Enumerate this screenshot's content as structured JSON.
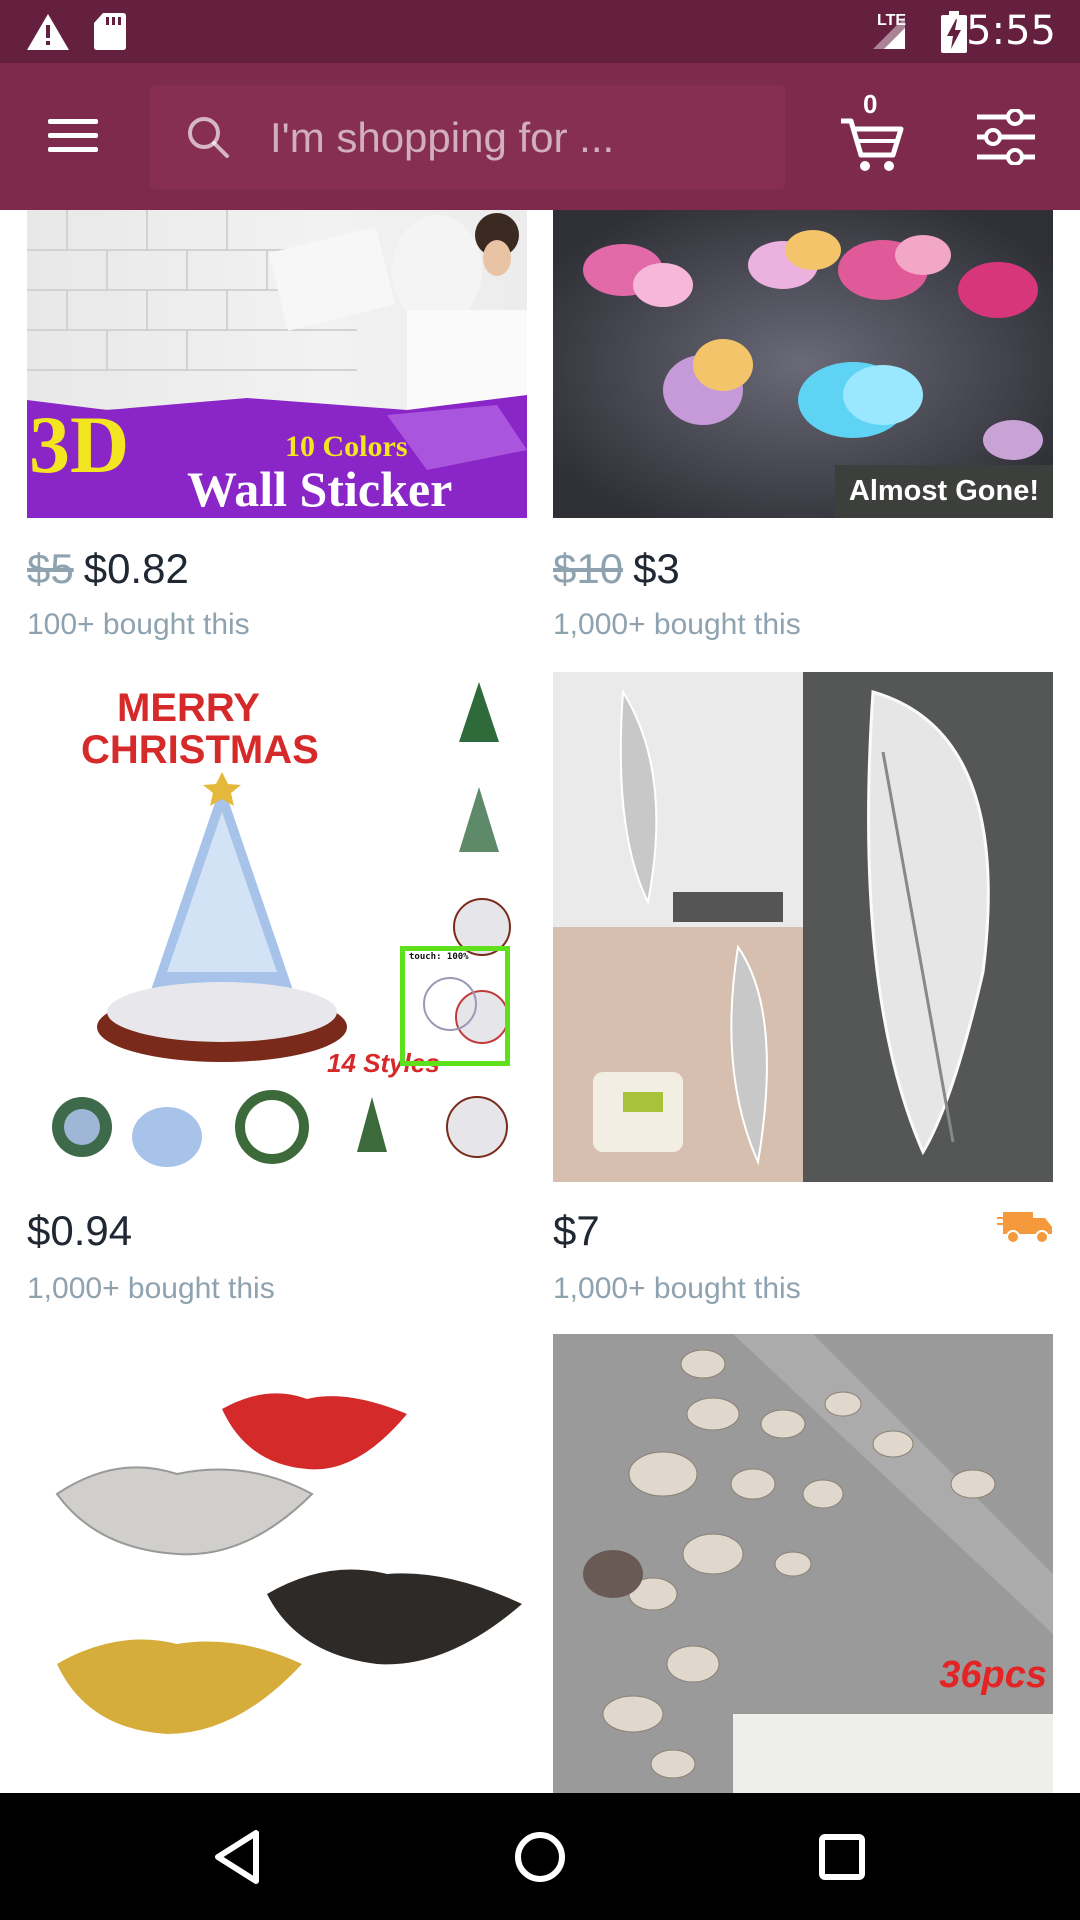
{
  "status_bar": {
    "time": "5:55",
    "network": "LTE"
  },
  "app_bar": {
    "search_placeholder": "I'm shopping for ...",
    "cart_count": "0"
  },
  "colors": {
    "status_bar": "#651f3f",
    "app_bar": "#7e2a4c",
    "search_box": "#862f52",
    "truck": "#f59a3c"
  },
  "products": [
    {
      "image": {
        "line1": "3D",
        "line2": "10 Colors",
        "line3": "Wall Sticker"
      },
      "old_price": "$5",
      "price": "$0.82",
      "bought": "100+ bought this"
    },
    {
      "image": {},
      "badge": "Almost Gone!",
      "old_price": "$10",
      "price": "$3",
      "bought": "1,000+ bought this"
    },
    {
      "image": {
        "line1": "MERRY",
        "line2": "CHRISTMAS",
        "line3": "14 Styles"
      },
      "price": "$0.94",
      "bought": "1,000+ bought this"
    },
    {
      "image": {},
      "price": "$7",
      "bought": "1,000+ bought this",
      "shipping_icon": "truck-icon"
    },
    {
      "image": {}
    },
    {
      "image": {
        "label": "36pcs"
      }
    }
  ],
  "touch_overlay": {
    "label": "touch: 100%"
  }
}
